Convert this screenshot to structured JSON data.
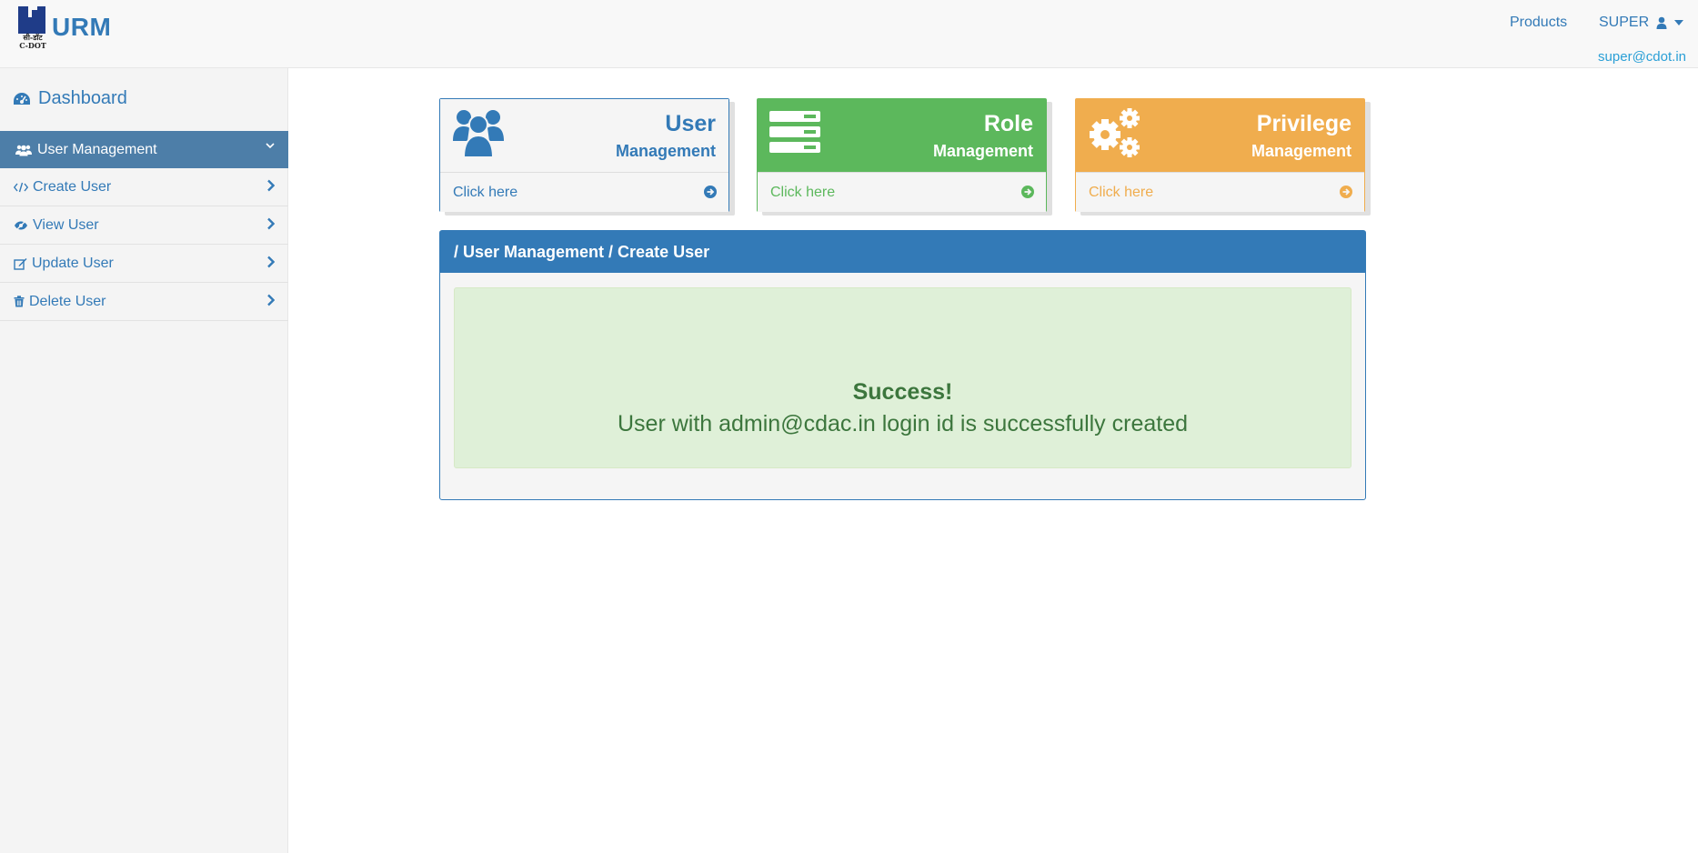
{
  "brand": {
    "name": "URM",
    "logo_text_line1": "सी-डॉट",
    "logo_text_line2": "C-DOT"
  },
  "topnav": {
    "products": "Products",
    "user": "SUPER",
    "email": "super@cdot.in"
  },
  "sidebar": {
    "dashboard": "Dashboard",
    "section": "User Management",
    "items": [
      {
        "label": "Create User"
      },
      {
        "label": "View User"
      },
      {
        "label": "Update User"
      },
      {
        "label": "Delete User"
      }
    ]
  },
  "cards": [
    {
      "title": "User",
      "subtitle": "Management",
      "link": "Click here",
      "color": "#337ab7"
    },
    {
      "title": "Role",
      "subtitle": "Management",
      "link": "Click here",
      "color": "#5cb85c"
    },
    {
      "title": "Privilege",
      "subtitle": "Management",
      "link": "Click here",
      "color": "#f0ad4e"
    }
  ],
  "panel": {
    "breadcrumb": "/ User Management / Create User",
    "alert_title": "Success!",
    "alert_message": "User with admin@cdac.in login id is successfully created"
  },
  "colors": {
    "primary": "#337ab7",
    "success": "#5cb85c",
    "warning": "#f0ad4e",
    "sidebar_active": "#4d7ea8",
    "alert_bg": "#dff0d8",
    "alert_text": "#3c763d"
  }
}
